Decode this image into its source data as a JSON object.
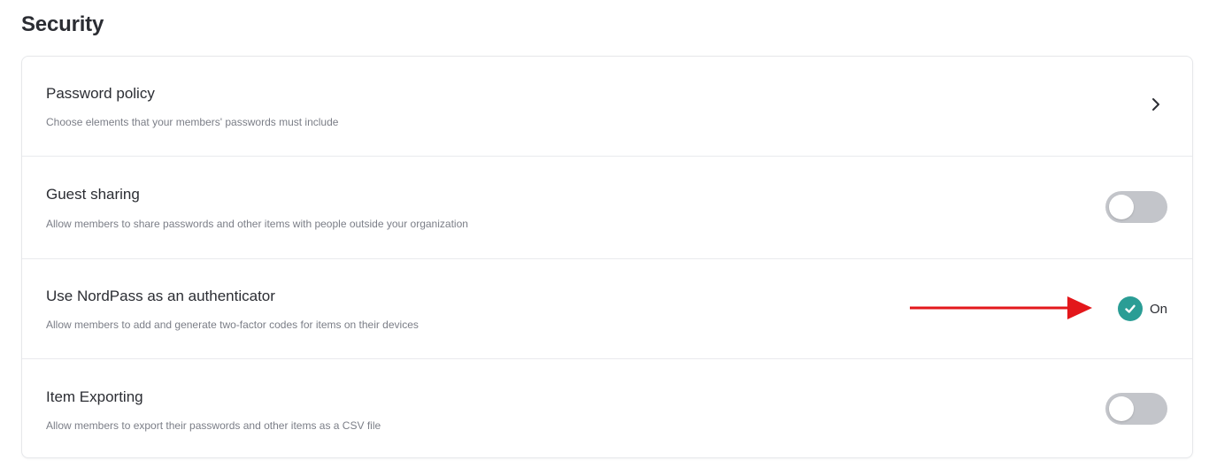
{
  "section": {
    "title": "Security"
  },
  "settings": [
    {
      "title": "Password policy",
      "description": "Choose elements that your members' passwords must include",
      "control": "chevron-right"
    },
    {
      "title": "Guest sharing",
      "description": "Allow members to share passwords and other items with people outside your organization",
      "control": "toggle",
      "enabled": false
    },
    {
      "title": "Use NordPass as an authenticator",
      "description": "Allow members to add and generate two-factor codes for items on their devices",
      "control": "status",
      "status_label": "On",
      "enabled": true
    },
    {
      "title": "Item Exporting",
      "description": "Allow members to export their passwords and other items as a CSV file",
      "control": "toggle",
      "enabled": false
    }
  ],
  "colors": {
    "accent_teal": "#2a9d95",
    "toggle_off": "#c3c5ca",
    "annotation_arrow": "#e3171b"
  },
  "icons": {
    "chevron": "chevron-right-icon",
    "check": "check-circle-icon",
    "annotation": "red-arrow-annotation"
  }
}
